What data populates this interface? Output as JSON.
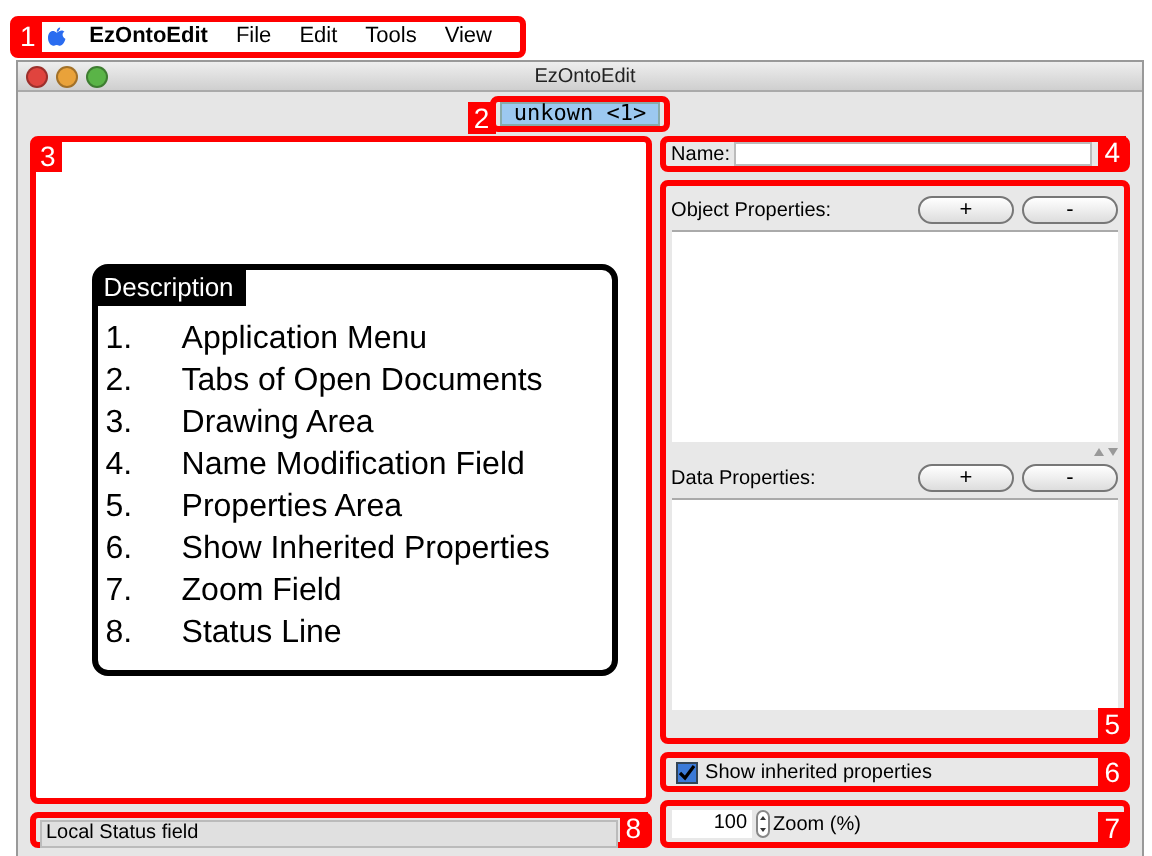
{
  "menu_bar": {
    "callout": "1",
    "app_name": "EzOntoEdit",
    "items": [
      "File",
      "Edit",
      "Tools",
      "View"
    ]
  },
  "window": {
    "title": "EzOntoEdit"
  },
  "tab_bar": {
    "callout": "2",
    "tabs": [
      {
        "label": "unkown <1>",
        "selected": true
      }
    ]
  },
  "drawing_area": {
    "callout": "3"
  },
  "description": {
    "title": "Description",
    "items": [
      {
        "number": "1.",
        "text": "Application Menu"
      },
      {
        "number": "2.",
        "text": "Tabs of Open Documents"
      },
      {
        "number": "3.",
        "text": "Drawing Area"
      },
      {
        "number": "4.",
        "text": "Name Modification Field"
      },
      {
        "number": "5.",
        "text": "Properties Area"
      },
      {
        "number": "6.",
        "text": "Show Inherited Properties"
      },
      {
        "number": "7.",
        "text": "Zoom Field"
      },
      {
        "number": "8.",
        "text": "Status Line"
      }
    ]
  },
  "name_field": {
    "callout": "4",
    "label": "Name:"
  },
  "properties": {
    "callout": "5",
    "sections": [
      {
        "label": "Object Properties:",
        "buttons": [
          "+",
          "-"
        ]
      },
      {
        "label": "Data Properties:",
        "buttons": [
          "+",
          "-"
        ]
      }
    ]
  },
  "show_inherited": {
    "callout": "6",
    "label": "Show inherited properties",
    "checked": true
  },
  "zoom": {
    "callout": "7",
    "value": "100",
    "label": "Zoom (%)"
  },
  "status_line": {
    "callout": "8",
    "text": "Local Status field"
  }
}
